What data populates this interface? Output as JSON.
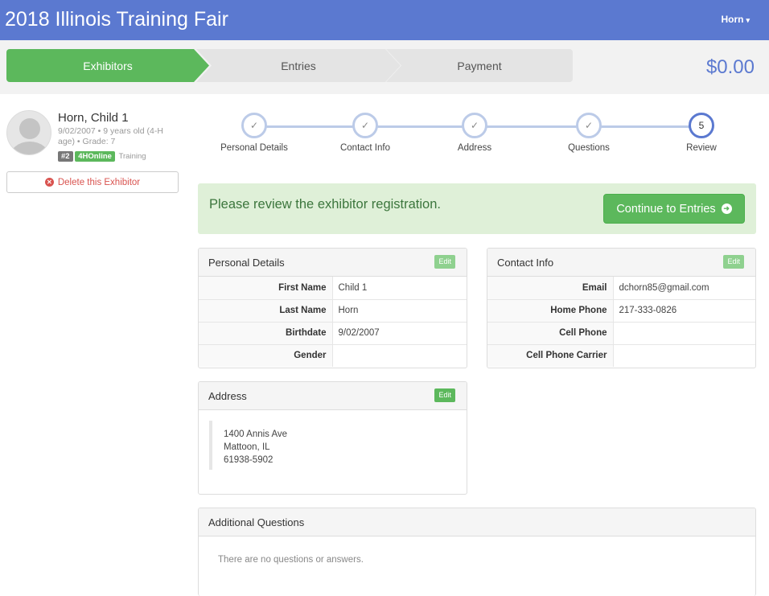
{
  "header": {
    "title": "2018 Illinois Training Fair",
    "user": "Horn",
    "caret": "▾"
  },
  "wizard": {
    "steps": [
      "Exhibitors",
      "Entries",
      "Payment"
    ],
    "total": "$0.00"
  },
  "exhibitor": {
    "name": "Horn, Child 1",
    "info": "9/02/2007 • 9 years old (4-H age) • Grade: 7",
    "badge_num": "#2",
    "badge_program": "4HOnline",
    "badge_text": "Training",
    "delete_label": "Delete this Exhibitor"
  },
  "progress": {
    "steps": [
      {
        "label": "Personal Details",
        "mark": "✓"
      },
      {
        "label": "Contact Info",
        "mark": "✓"
      },
      {
        "label": "Address",
        "mark": "✓"
      },
      {
        "label": "Questions",
        "mark": "✓"
      },
      {
        "label": "Review",
        "mark": "5"
      }
    ]
  },
  "review": {
    "message": "Please review the exhibitor registration.",
    "continue_label": "Continue to Entries"
  },
  "personal": {
    "title": "Personal Details",
    "edit": "Edit",
    "rows": [
      {
        "k": "First Name",
        "v": "Child 1"
      },
      {
        "k": "Last Name",
        "v": "Horn"
      },
      {
        "k": "Birthdate",
        "v": "9/02/2007"
      },
      {
        "k": "Gender",
        "v": ""
      }
    ]
  },
  "contact": {
    "title": "Contact Info",
    "edit": "Edit",
    "rows": [
      {
        "k": "Email",
        "v": "dchorn85@gmail.com"
      },
      {
        "k": "Home Phone",
        "v": "217-333-0826"
      },
      {
        "k": "Cell Phone",
        "v": ""
      },
      {
        "k": "Cell Phone Carrier",
        "v": ""
      }
    ]
  },
  "address": {
    "title": "Address",
    "edit": "Edit",
    "line1": "1400 Annis Ave",
    "line2": "Mattoon, IL",
    "line3": "61938-5902"
  },
  "questions": {
    "title": "Additional Questions",
    "empty": "There are no questions or answers."
  },
  "colors": {
    "header": "#5b79d0",
    "success": "#5cb85c",
    "danger": "#d9534f",
    "alert_bg": "#dff0d8"
  },
  "icons": {
    "delete": "times-circle-icon",
    "continue": "arrow-circle-right-icon",
    "check": "check-icon",
    "avatar": "user-avatar-icon"
  }
}
